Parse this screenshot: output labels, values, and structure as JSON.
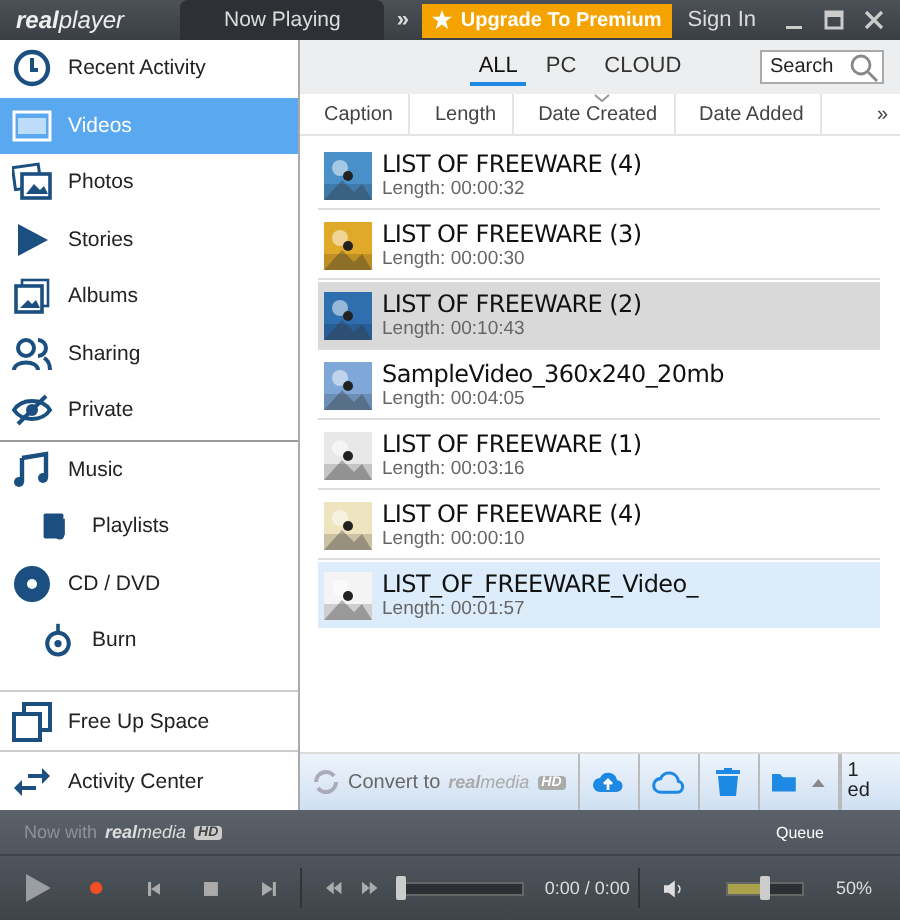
{
  "top_bar": {
    "logo": "**real**player",
    "tabs": [
      {
        "label": "Now Playing",
        "selected": true
      }
    ],
    "more": "»",
    "upgrade": "Upgrade To Premium",
    "sign_in": "Sign In"
  },
  "sidebar": {
    "items": [
      {
        "label": "Recent Activity",
        "selected": false
      },
      {
        "label": "Videos",
        "selected": true
      },
      {
        "label": "Photos",
        "selected": false
      },
      {
        "label": "Stories",
        "selected": false
      },
      {
        "label": "Albums",
        "selected": false
      },
      {
        "label": "Sharing",
        "selected": false
      },
      {
        "label": "Private",
        "selected": false
      },
      {
        "label": "Music",
        "selected": false,
        "children": [
          {
            "label": "Playlists",
            "selected": false
          }
        ]
      },
      {
        "label": "CD / DVD",
        "selected": false,
        "children": [
          {
            "label": "Burn",
            "selected": false
          }
        ]
      }
    ],
    "footer": [
      {
        "label": "Free Up Space"
      },
      {
        "label": "Activity Center"
      }
    ]
  },
  "filters": [
    {
      "label": "ALL",
      "selected": true
    },
    {
      "label": "PC",
      "selected": false
    },
    {
      "label": "CLOUD",
      "selected": false
    }
  ],
  "search": {
    "placeholder": "Search"
  },
  "columns": [
    "Caption",
    "Length",
    "Date Created",
    "Date Added"
  ],
  "columns_more": "»",
  "videos": [
    {
      "title": "LIST OF FREEWARE (4)",
      "length": "Length: 00:00:32",
      "selected": false,
      "hovered": false
    },
    {
      "title": "LIST OF FREEWARE (3)",
      "length": "Length: 00:00:30",
      "selected": false,
      "hovered": false
    },
    {
      "title": "LIST OF FREEWARE (2)",
      "length": "Length: 00:10:43",
      "selected": true,
      "hovered": false
    },
    {
      "title": "SampleVideo_360x240_20mb",
      "length": "Length: 00:04:05",
      "selected": false,
      "hovered": false
    },
    {
      "title": "LIST OF FREEWARE (1)",
      "length": "Length: 00:03:16",
      "selected": false,
      "hovered": false
    },
    {
      "title": "LIST OF FREEWARE (4)",
      "length": "Length: 00:00:10",
      "selected": false,
      "hovered": false
    },
    {
      "title": "LIST_OF_FREEWARE_Video_",
      "length": "Length: 00:01:57",
      "selected": false,
      "hovered": true
    }
  ],
  "action_bar": {
    "convert": "Convert to",
    "convert_logo": "**real**media",
    "convert_badge": "HD",
    "fragment": [
      "1",
      "ed"
    ]
  },
  "player": {
    "promo": "Now with",
    "promo_logo": "**real**media",
    "promo_badge": "HD",
    "queue": "Queue",
    "seek": {
      "level": 0
    },
    "time": "0:00 / 0:00",
    "volume": {
      "level": 0.5
    },
    "volume_reading": "50%"
  }
}
